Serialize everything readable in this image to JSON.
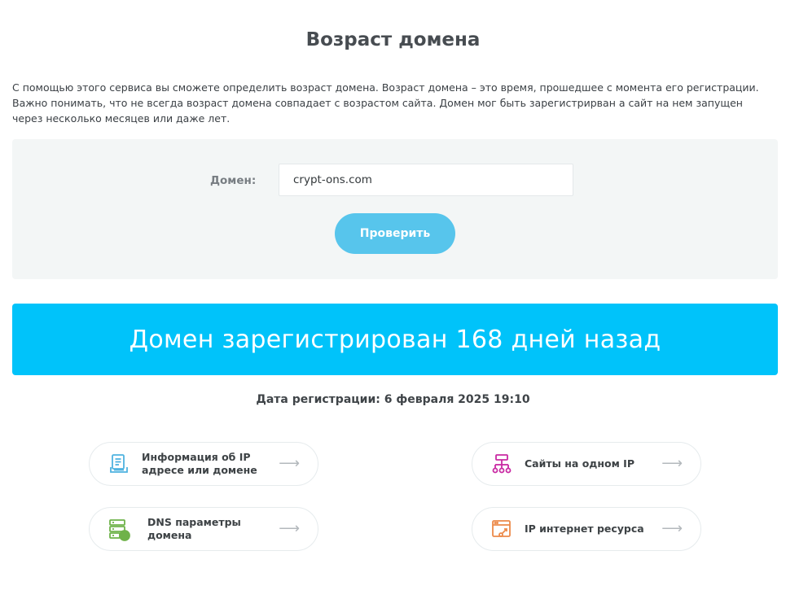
{
  "page": {
    "title": "Возраст домена",
    "description": "С помощью этого сервиса вы сможете определить возраст домена. Возраст домена – это время, прошедшее с момента его регистрации. Важно понимать, что не всегда возраст домена совпадает с возрастом сайта. Домен мог быть зарегистрирван а сайт на нем запущен через несколько месяцев или даже лет."
  },
  "form": {
    "domain_label": "Домен:",
    "domain_value": "crypt-ons.com",
    "submit_label": "Проверить"
  },
  "result": {
    "banner_text": "Домен зарегистрирован 168 дней назад",
    "registration_date": "Дата регистрации: 6 февраля 2025 19:10"
  },
  "links": [
    {
      "label": "Информация об IP адресе или домене",
      "icon": "document-info-icon",
      "color": "#4fb3e0"
    },
    {
      "label": "Сайты на одном IP",
      "icon": "sitemap-icon",
      "color": "#c92aa3"
    },
    {
      "label": "DNS параметры домена",
      "icon": "dns-server-icon",
      "color": "#6fb24a"
    },
    {
      "label": "IP интернет ресурса",
      "icon": "browser-link-icon",
      "color": "#ec8a4a"
    }
  ],
  "colors": {
    "accent": "#00c3fa",
    "button": "#57c5ec",
    "form_bg": "#f3f6f6"
  }
}
